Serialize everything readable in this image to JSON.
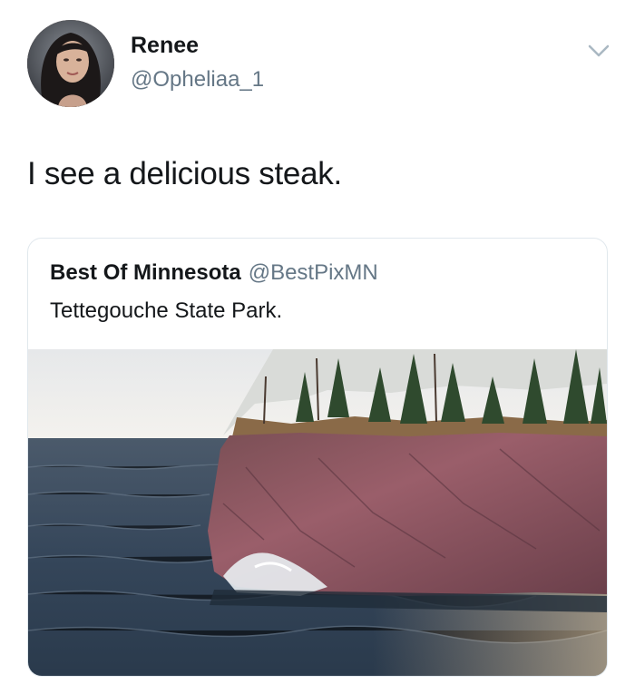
{
  "author": {
    "display_name": "Renee",
    "handle": "@Opheliaa_1"
  },
  "tweet": {
    "text": "I see a delicious steak."
  },
  "quoted_tweet": {
    "display_name": "Best Of Minnesota",
    "handle": "@BestPixMN",
    "text": "Tettegouche State Park."
  },
  "icons": {
    "menu": "chevron-down-icon"
  }
}
